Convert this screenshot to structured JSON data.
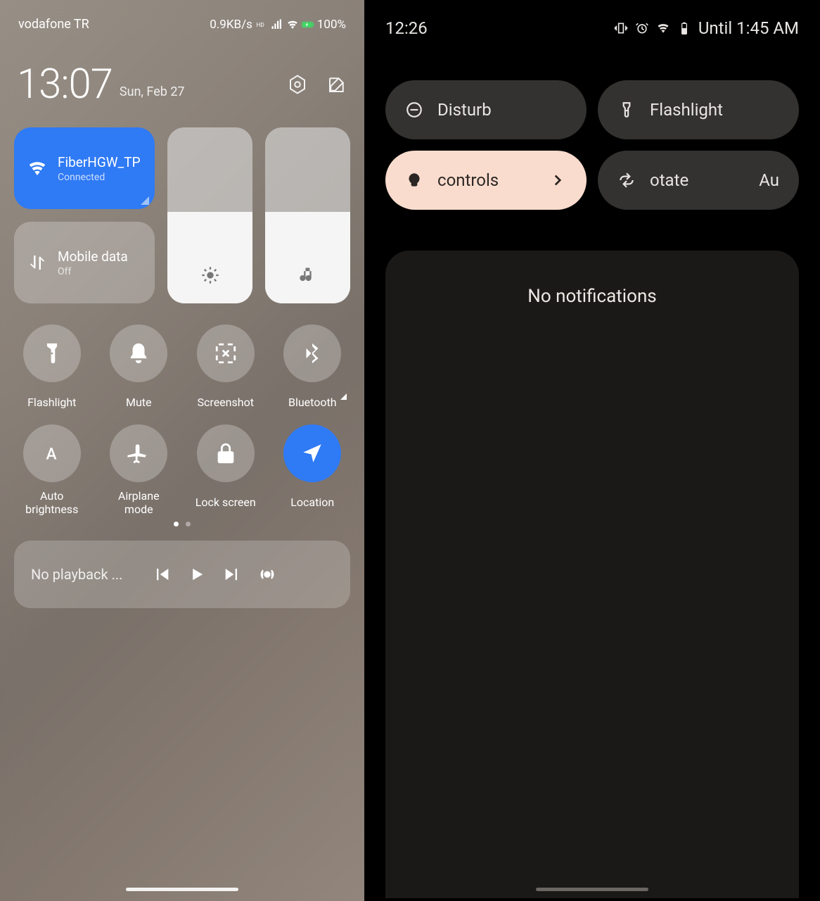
{
  "left": {
    "status": {
      "carrier": "vodafone TR",
      "speed": "0.9KB/s",
      "battery": "100%"
    },
    "clock": "13:07",
    "date": "Sun, Feb 27",
    "wifi": {
      "name": "FiberHGW_TP",
      "sub": "Connected"
    },
    "mobile": {
      "name": "Mobile data",
      "sub": "Off"
    },
    "brightness_pct": 52,
    "volume_pct": 52,
    "tiles": [
      {
        "label": "Flashlight"
      },
      {
        "label": "Mute"
      },
      {
        "label": "Screenshot"
      },
      {
        "label": "Bluetooth",
        "expandable": true
      },
      {
        "label": "Auto\nbrightness"
      },
      {
        "label": "Airplane\nmode"
      },
      {
        "label": "Lock screen"
      },
      {
        "label": "Location",
        "on": true
      }
    ],
    "media_text": "No playback ..."
  },
  "right": {
    "clock": "12:26",
    "battery_until": "Until 1:45 AM",
    "tiles": {
      "disturb": "Disturb",
      "flashlight": "Flashlight",
      "controls": "controls",
      "rotate_a": "otate",
      "rotate_b": "Au"
    },
    "notifications": "No notifications"
  }
}
